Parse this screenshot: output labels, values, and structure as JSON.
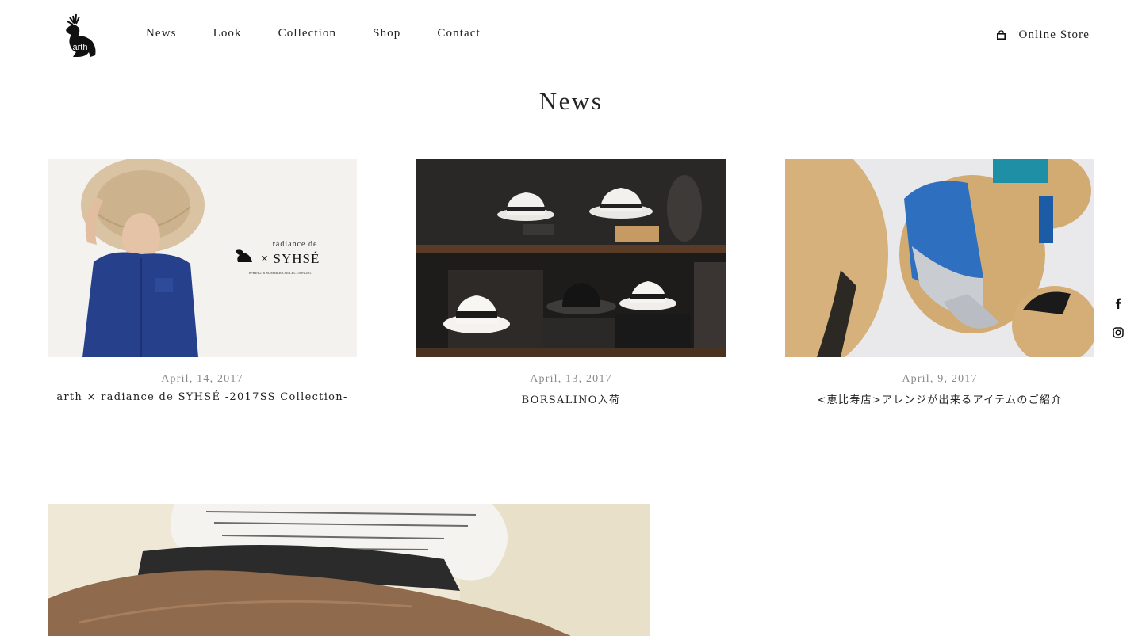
{
  "header": {
    "logo_text": "arth",
    "nav": [
      {
        "label": "News"
      },
      {
        "label": "Look"
      },
      {
        "label": "Collection"
      },
      {
        "label": "Shop"
      },
      {
        "label": "Contact"
      }
    ],
    "online_store_label": "Online Store"
  },
  "page_title": "News",
  "articles": [
    {
      "date": "April, 14, 2017",
      "title": "arth × radiance de SYHSÉ -2017SS Collection-",
      "image_text": {
        "line1": "radiance de",
        "brand": "× SYHSÉ",
        "line3": "SPRING & SUMMER COLLECTION 2017"
      }
    },
    {
      "date": "April, 13, 2017",
      "title": "BORSALINO入荷"
    },
    {
      "date": "April, 9, 2017",
      "title": "<恵比寿店>アレンジが出来るアイテムのご紹介"
    }
  ],
  "social": {
    "facebook_icon": "facebook-icon",
    "instagram_icon": "instagram-icon"
  },
  "colors": {
    "text": "#222222",
    "date": "#8a8a8a",
    "background": "#ffffff"
  }
}
